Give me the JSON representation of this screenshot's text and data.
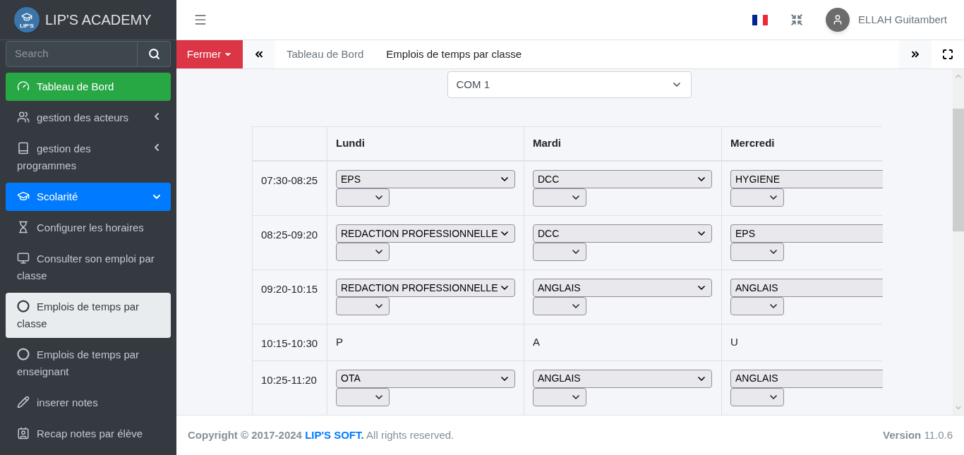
{
  "brand": {
    "name": "LIP'S ACADEMY",
    "logo_text": "LIP'S"
  },
  "search": {
    "placeholder": "Search"
  },
  "sidebar": {
    "items": [
      {
        "label": "Tableau de Bord",
        "kind": "link",
        "selected": true
      },
      {
        "label": "gestion des acteurs",
        "kind": "group",
        "expanded": false
      },
      {
        "label": "gestion des programmes",
        "kind": "group",
        "expanded": false
      },
      {
        "label": "Scolarité",
        "kind": "group",
        "expanded": true,
        "children": [
          {
            "label": "Configurer les horaires",
            "selected": false
          },
          {
            "label": "Consulter son emploi par classe",
            "selected": false
          },
          {
            "label": "Emplois de temps par classe",
            "selected": true
          },
          {
            "label": "Emplois de temps par enseignant",
            "selected": false
          },
          {
            "label": "inserer notes",
            "selected": false
          },
          {
            "label": "Recap notes par élève",
            "selected": false
          }
        ]
      }
    ]
  },
  "header": {
    "user": "ELLAH Guitambert"
  },
  "tabbar": {
    "close_button": "Fermer",
    "tabs": [
      {
        "label": "Tableau de Bord",
        "selected": false
      },
      {
        "label": "Emplois de temps par classe",
        "selected": true
      }
    ]
  },
  "class_select": {
    "value": "COM 1"
  },
  "table": {
    "columns": [
      "Lundi",
      "Mardi",
      "Mercredi"
    ],
    "rows": [
      {
        "time": "07:30-08:25",
        "cells": [
          {
            "kind": "select",
            "value": "EPS"
          },
          {
            "kind": "select",
            "value": "DCC"
          },
          {
            "kind": "select",
            "value": "HYGIENE"
          }
        ]
      },
      {
        "time": "08:25-09:20",
        "cells": [
          {
            "kind": "select",
            "value": "REDACTION PROFESSIONNELLE"
          },
          {
            "kind": "select",
            "value": "DCC"
          },
          {
            "kind": "select",
            "value": "EPS"
          }
        ]
      },
      {
        "time": "09:20-10:15",
        "cells": [
          {
            "kind": "select",
            "value": "REDACTION PROFESSIONNELLE"
          },
          {
            "kind": "select",
            "value": "ANGLAIS"
          },
          {
            "kind": "select",
            "value": "ANGLAIS"
          }
        ]
      },
      {
        "time": "10:15-10:30",
        "cells": [
          {
            "kind": "text",
            "value": "P"
          },
          {
            "kind": "text",
            "value": "A"
          },
          {
            "kind": "text",
            "value": "U"
          }
        ]
      },
      {
        "time": "10:25-11:20",
        "cells": [
          {
            "kind": "select",
            "value": "OTA"
          },
          {
            "kind": "select",
            "value": "ANGLAIS"
          },
          {
            "kind": "select",
            "value": "ANGLAIS"
          }
        ]
      }
    ]
  },
  "footer": {
    "copyright": "Copyright © 2017-2024",
    "company": "LIP'S SOFT.",
    "rights": "All rights reserved.",
    "version_label": "Version",
    "version": "11.0.6"
  }
}
